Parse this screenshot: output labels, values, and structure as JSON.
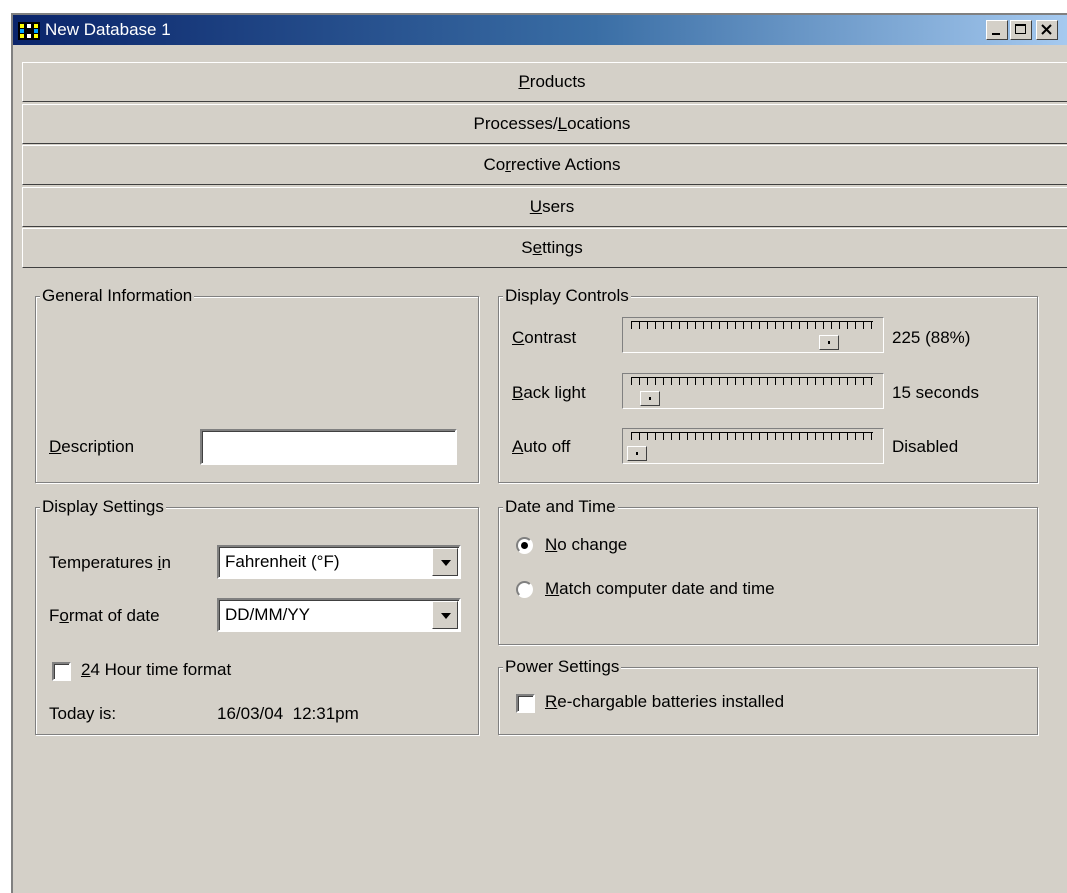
{
  "window": {
    "title": "New Database 1"
  },
  "tabs": [
    {
      "pre": "",
      "key": "P",
      "post": "roducts"
    },
    {
      "pre": "Processes/",
      "key": "L",
      "post": "ocations"
    },
    {
      "pre": "Co",
      "key": "r",
      "post": "rective Actions"
    },
    {
      "pre": "",
      "key": "U",
      "post": "sers"
    },
    {
      "pre": "S",
      "key": "e",
      "post": "ttings"
    }
  ],
  "general": {
    "legend": "General Information",
    "description_label_key": "D",
    "description_label_rest": "escription",
    "description_value": ""
  },
  "display_settings": {
    "legend": "Display Settings",
    "temperatures_label_pre": "Temperatures ",
    "temperatures_label_key": "i",
    "temperatures_label_post": "n",
    "temperatures_value": "Fahrenheit (°F)",
    "date_format_label_pre": "F",
    "date_format_label_key": "o",
    "date_format_label_post": "rmat of date",
    "date_format_value": "DD/MM/YY",
    "hour24_key": "2",
    "hour24_rest": "4 Hour time format",
    "hour24_checked": false,
    "today_label": "Today is:",
    "today_value": "16/03/04  12:31pm"
  },
  "display_controls": {
    "legend": "Display Controls",
    "contrast": {
      "key": "C",
      "rest": "ontrast",
      "value_text": "225 (88%)",
      "position": 0.88
    },
    "backlight": {
      "key": "B",
      "rest": "ack light",
      "value_text": "15 seconds",
      "position": 0.06
    },
    "autooff": {
      "key": "A",
      "rest": "uto off",
      "value_text": "Disabled",
      "position": 0.0
    }
  },
  "date_time": {
    "legend": "Date and Time",
    "no_change_key": "N",
    "no_change_rest": "o change",
    "match_key": "M",
    "match_rest": "atch computer date and time",
    "selected": "no_change"
  },
  "power": {
    "legend": "Power Settings",
    "batteries_key": "R",
    "batteries_rest": "e-chargable batteries installed",
    "batteries_checked": false
  },
  "colors": {
    "title_start": "#0a246a",
    "title_end": "#a6caf0",
    "face": "#d4d0c8"
  }
}
